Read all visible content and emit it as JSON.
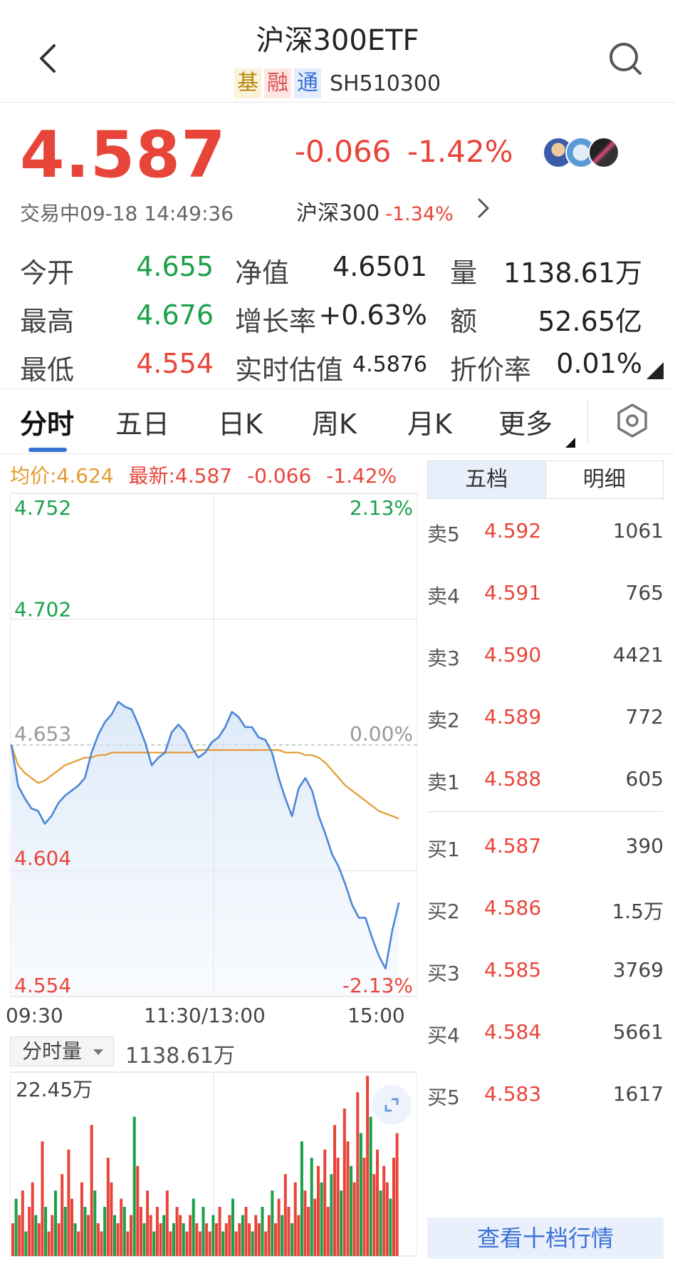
{
  "header": {
    "title": "沪深300ETF",
    "tags": [
      {
        "text": "基",
        "color": "#b8860b",
        "bg": "#fbf2dc"
      },
      {
        "text": "融",
        "color": "#d9534f",
        "bg": "#fde6e4"
      },
      {
        "text": "通",
        "color": "#3a72d8",
        "bg": "#e4edfb"
      }
    ],
    "code": "SH510300"
  },
  "quote": {
    "price": "4.587",
    "change": "-0.066",
    "change_pct": "-1.42%",
    "status": "交易中09-18 14:49:36",
    "index_name": "沪深300",
    "index_pct": "-1.34%"
  },
  "stats": {
    "open_label": "今开",
    "open": "4.655",
    "high_label": "最高",
    "high": "4.676",
    "low_label": "最低",
    "low": "4.554",
    "nav_label": "净值",
    "nav": "4.6501",
    "growth_label": "增长率",
    "growth": "+0.63%",
    "est_label": "实时估值",
    "est": "4.5876",
    "vol_label": "量",
    "vol": "1138.61万",
    "amt_label": "额",
    "amt": "52.65亿",
    "disc_label": "折价率",
    "disc": "0.01%"
  },
  "tabs": [
    "分时",
    "五日",
    "日K",
    "周K",
    "月K",
    "更多"
  ],
  "legend": {
    "avg": "均价:4.624",
    "last": "最新:4.587",
    "chg": "-0.066",
    "pct": "-1.42%"
  },
  "chart_data": {
    "type": "line",
    "y_left_labels": [
      "4.752",
      "4.702",
      "4.653",
      "4.604",
      "4.554"
    ],
    "y_right_labels": [
      "2.13%",
      "0.00%",
      "-2.13%"
    ],
    "x_labels": [
      "09:30",
      "11:30/13:00",
      "15:00"
    ],
    "ylim": [
      4.554,
      4.752
    ],
    "base": 4.653,
    "series": [
      {
        "name": "最新",
        "color": "#4a86d8",
        "values": [
          4.653,
          4.637,
          4.632,
          4.628,
          4.627,
          4.622,
          4.625,
          4.63,
          4.633,
          4.635,
          4.637,
          4.64,
          4.65,
          4.657,
          4.662,
          4.665,
          4.67,
          4.668,
          4.667,
          4.661,
          4.654,
          4.645,
          4.648,
          4.65,
          4.658,
          4.661,
          4.658,
          4.652,
          4.648,
          4.65,
          4.654,
          4.656,
          4.66,
          4.666,
          4.664,
          4.66,
          4.66,
          4.656,
          4.655,
          4.65,
          4.64,
          4.632,
          4.625,
          4.636,
          4.64,
          4.635,
          4.625,
          4.618,
          4.61,
          4.605,
          4.598,
          4.59,
          4.585,
          4.585,
          4.577,
          4.57,
          4.565,
          4.58,
          4.591
        ]
      },
      {
        "name": "均价",
        "color": "#e39a2e",
        "values": [
          4.653,
          4.645,
          4.642,
          4.64,
          4.638,
          4.639,
          4.641,
          4.643,
          4.645,
          4.646,
          4.647,
          4.648,
          4.648,
          4.649,
          4.649,
          4.65,
          4.65,
          4.65,
          4.65,
          4.65,
          4.65,
          4.65,
          4.65,
          4.65,
          4.65,
          4.65,
          4.65,
          4.65,
          4.651,
          4.651,
          4.651,
          4.651,
          4.651,
          4.651,
          4.651,
          4.651,
          4.651,
          4.651,
          4.651,
          4.651,
          4.651,
          4.65,
          4.65,
          4.65,
          4.649,
          4.649,
          4.648,
          4.646,
          4.643,
          4.64,
          4.637,
          4.635,
          4.633,
          4.631,
          4.629,
          4.627,
          4.626,
          4.625,
          4.624
        ]
      }
    ]
  },
  "volume": {
    "selector": "分时量",
    "total": "1138.61万",
    "max_label": "22.45万",
    "max": 22.45,
    "bars": [
      4,
      7,
      5,
      8,
      3,
      6,
      9,
      5,
      4,
      14,
      6,
      3,
      5,
      8,
      4,
      10,
      6,
      13,
      7,
      4,
      3,
      9,
      6,
      5,
      16,
      8,
      4,
      3,
      6,
      12,
      9,
      5,
      4,
      7,
      6,
      3,
      5,
      17,
      11,
      6,
      4,
      8,
      5,
      3,
      6,
      4,
      5,
      8,
      3,
      4,
      6,
      5,
      4,
      3,
      5,
      7,
      4,
      3,
      6,
      4,
      3,
      5,
      4,
      6,
      3,
      4,
      5,
      7,
      3,
      4,
      5,
      6,
      4,
      3,
      5,
      4,
      6,
      3,
      5,
      8,
      4,
      7,
      5,
      10,
      6,
      4,
      9,
      5,
      14,
      8,
      6,
      12,
      7,
      11,
      9,
      13,
      6,
      10,
      16,
      12,
      8,
      18,
      14,
      11,
      9,
      20,
      15,
      12,
      22,
      17,
      10,
      13,
      8,
      11,
      9,
      7,
      12,
      15
    ],
    "colors": [
      "#e8453a",
      "#1aa14a"
    ]
  },
  "orderbook": {
    "tabs": [
      "五档",
      "明细"
    ],
    "asks": [
      {
        "label": "卖5",
        "price": "4.592",
        "vol": "1061"
      },
      {
        "label": "卖4",
        "price": "4.591",
        "vol": "765"
      },
      {
        "label": "卖3",
        "price": "4.590",
        "vol": "4421"
      },
      {
        "label": "卖2",
        "price": "4.589",
        "vol": "772"
      },
      {
        "label": "卖1",
        "price": "4.588",
        "vol": "605"
      }
    ],
    "bids": [
      {
        "label": "买1",
        "price": "4.587",
        "vol": "390"
      },
      {
        "label": "买2",
        "price": "4.586",
        "vol": "1.5万"
      },
      {
        "label": "买3",
        "price": "4.585",
        "vol": "3769"
      },
      {
        "label": "买4",
        "price": "4.584",
        "vol": "5661"
      },
      {
        "label": "买5",
        "price": "4.583",
        "vol": "1617"
      }
    ],
    "more": "查看十档行情"
  },
  "icons": [
    "back-arrow-icon",
    "search-icon",
    "chevron-right-icon",
    "settings-hexagon-icon",
    "expand-icon"
  ]
}
